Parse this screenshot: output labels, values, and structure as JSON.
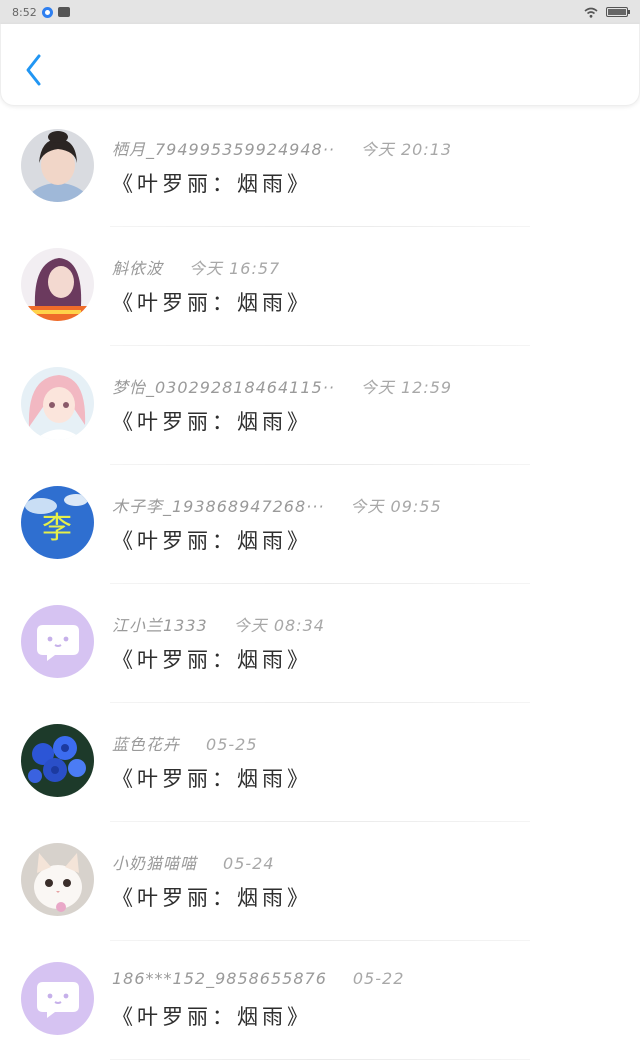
{
  "status_bar": {
    "time": "8:52",
    "battery_label": "99",
    "battery_level": 0.99
  },
  "header": {
    "back_icon": "chevron-left-icon"
  },
  "comments": [
    {
      "user": "栖月_794995359924948··",
      "time": "今天  20:13",
      "text": "《叶罗丽：烟雨》",
      "avatar": "girl-portrait"
    },
    {
      "user": "斛依波",
      "time": "今天  16:57",
      "text": "《叶罗丽：烟雨》",
      "avatar": "girl-purple-hair"
    },
    {
      "user": "梦怡_030292818464115··",
      "time": "今天  12:59",
      "text": "《叶罗丽：烟雨》",
      "avatar": "anime-girl-pink"
    },
    {
      "user": "木子李_193868947268···",
      "time": "今天  09:55",
      "text": "《叶罗丽：烟雨》",
      "avatar": "blue-sky-li"
    },
    {
      "user": "江小兰1333",
      "time": "今天  08:34",
      "text": "《叶罗丽：烟雨》",
      "avatar": "default-chat"
    },
    {
      "user": "蓝色花卉",
      "time": "05-25",
      "text": "《叶罗丽：烟雨》",
      "avatar": "blue-roses"
    },
    {
      "user": "小奶猫喵喵",
      "time": "05-24",
      "text": "《叶罗丽：烟雨》",
      "avatar": "white-kitten"
    },
    {
      "user": "186***152_9858655876",
      "time": "05-22",
      "text": "《叶罗丽：烟雨》",
      "avatar": "default-chat"
    }
  ],
  "colors": {
    "accent": "#2196f3",
    "default_avatar": "#d6c3f2"
  }
}
